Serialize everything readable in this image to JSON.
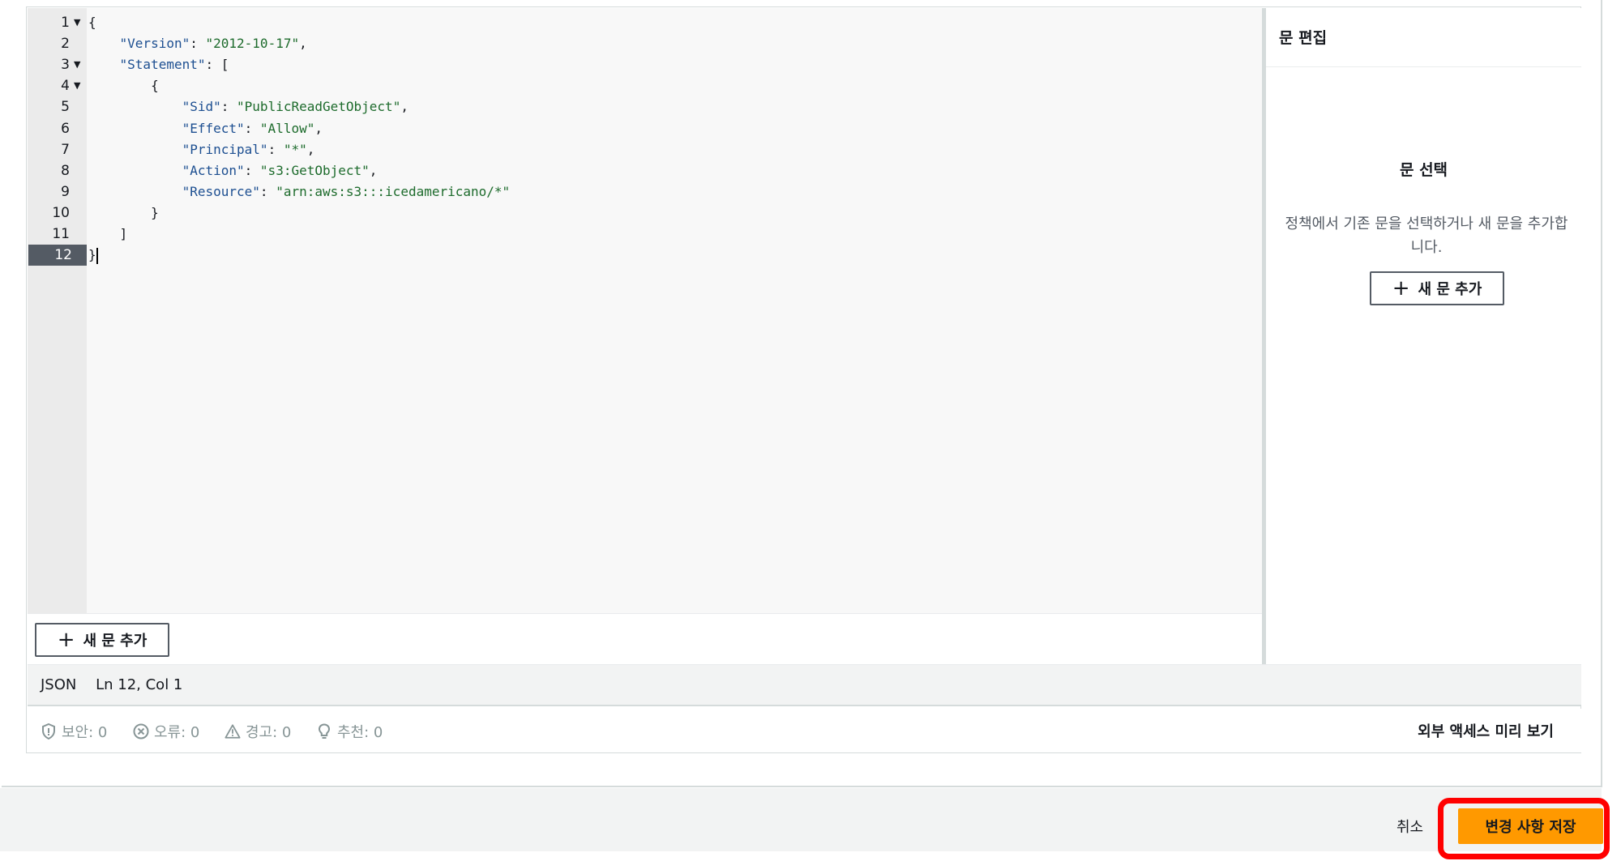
{
  "editor": {
    "lines": [
      {
        "n": "1",
        "fold": true,
        "tokens": [
          {
            "t": "{",
            "c": "punc"
          }
        ]
      },
      {
        "n": "2",
        "fold": false,
        "tokens": [
          {
            "t": "    ",
            "c": "punc"
          },
          {
            "t": "\"Version\"",
            "c": "key"
          },
          {
            "t": ": ",
            "c": "punc"
          },
          {
            "t": "\"2012-10-17\"",
            "c": "str"
          },
          {
            "t": ",",
            "c": "punc"
          }
        ]
      },
      {
        "n": "3",
        "fold": true,
        "tokens": [
          {
            "t": "    ",
            "c": "punc"
          },
          {
            "t": "\"Statement\"",
            "c": "key"
          },
          {
            "t": ": [",
            "c": "punc"
          }
        ]
      },
      {
        "n": "4",
        "fold": true,
        "tokens": [
          {
            "t": "        {",
            "c": "punc"
          }
        ]
      },
      {
        "n": "5",
        "fold": false,
        "tokens": [
          {
            "t": "            ",
            "c": "punc"
          },
          {
            "t": "\"Sid\"",
            "c": "key"
          },
          {
            "t": ": ",
            "c": "punc"
          },
          {
            "t": "\"PublicReadGetObject\"",
            "c": "str"
          },
          {
            "t": ",",
            "c": "punc"
          }
        ]
      },
      {
        "n": "6",
        "fold": false,
        "tokens": [
          {
            "t": "            ",
            "c": "punc"
          },
          {
            "t": "\"Effect\"",
            "c": "key"
          },
          {
            "t": ": ",
            "c": "punc"
          },
          {
            "t": "\"Allow\"",
            "c": "str"
          },
          {
            "t": ",",
            "c": "punc"
          }
        ]
      },
      {
        "n": "7",
        "fold": false,
        "tokens": [
          {
            "t": "            ",
            "c": "punc"
          },
          {
            "t": "\"Principal\"",
            "c": "key"
          },
          {
            "t": ": ",
            "c": "punc"
          },
          {
            "t": "\"*\"",
            "c": "str"
          },
          {
            "t": ",",
            "c": "punc"
          }
        ]
      },
      {
        "n": "8",
        "fold": false,
        "tokens": [
          {
            "t": "            ",
            "c": "punc"
          },
          {
            "t": "\"Action\"",
            "c": "key"
          },
          {
            "t": ": ",
            "c": "punc"
          },
          {
            "t": "\"s3:GetObject\"",
            "c": "str"
          },
          {
            "t": ",",
            "c": "punc"
          }
        ]
      },
      {
        "n": "9",
        "fold": false,
        "tokens": [
          {
            "t": "            ",
            "c": "punc"
          },
          {
            "t": "\"Resource\"",
            "c": "key"
          },
          {
            "t": ": ",
            "c": "punc"
          },
          {
            "t": "\"arn:aws:s3:::icedamericano/*\"",
            "c": "str"
          }
        ]
      },
      {
        "n": "10",
        "fold": false,
        "tokens": [
          {
            "t": "        }",
            "c": "punc"
          }
        ]
      },
      {
        "n": "11",
        "fold": false,
        "tokens": [
          {
            "t": "    ]",
            "c": "punc"
          }
        ]
      },
      {
        "n": "12",
        "fold": false,
        "active": true,
        "tokens": [
          {
            "t": "}",
            "c": "punc"
          }
        ]
      }
    ],
    "add_statement_label": "새 문 추가",
    "status": {
      "language": "JSON",
      "position": "Ln 12, Col 1"
    }
  },
  "validation": {
    "security": "보안: 0",
    "errors": "오류: 0",
    "warnings": "경고: 0",
    "suggestions": "추천: 0",
    "external_access_preview": "외부 액세스 미리 보기"
  },
  "side_panel": {
    "title": "문 편집",
    "select_heading": "문 선택",
    "description": "정책에서 기존 문을 선택하거나 새 문을 추가합니다.",
    "add_statement_label": "새 문 추가"
  },
  "footer": {
    "cancel_label": "취소",
    "save_label": "변경 사항 저장"
  },
  "colors": {
    "primary_button": "#ff9900",
    "highlight_annotation": "#ff0000",
    "json_key": "#1d4f91",
    "json_string": "#1d6b2c"
  }
}
